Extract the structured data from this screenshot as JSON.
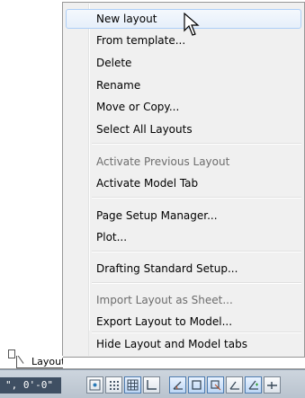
{
  "menu": {
    "items": [
      {
        "label": "New layout",
        "state": "hover"
      },
      {
        "label": "From template..."
      },
      {
        "label": "Delete"
      },
      {
        "label": "Rename"
      },
      {
        "label": "Move or Copy..."
      },
      {
        "label": "Select All Layouts"
      },
      {
        "label": "Activate Previous Layout",
        "state": "disabled"
      },
      {
        "label": "Activate Model Tab"
      },
      {
        "label": "Page Setup Manager..."
      },
      {
        "label": "Plot..."
      },
      {
        "label": "Drafting Standard Setup..."
      },
      {
        "label": "Import Layout as Sheet...",
        "state": "disabled"
      },
      {
        "label": "Export Layout to Model..."
      },
      {
        "label": "Hide Layout and Model tabs"
      }
    ]
  },
  "tabs": {
    "layout_tab": "Layout"
  },
  "statusbar": {
    "coordinates": "\", 0'-0\"",
    "icons": [
      "snap-icon",
      "grid-display-icon",
      "grid-icon",
      "ortho-icon",
      "polar-tracking-icon",
      "object-snap-icon",
      "object-snap-tracking-icon",
      "dynamic-ucs-icon",
      "dynamic-input-icon",
      "lineweight-icon"
    ]
  },
  "colors": {
    "menu_bg": "#f0f0f0",
    "menu_border": "#979797",
    "hover_border": "#aecff7",
    "disabled_text": "#6d6d6d",
    "statusbar_bg": "#c3ccd6",
    "coords_bg": "#3f4f63"
  }
}
